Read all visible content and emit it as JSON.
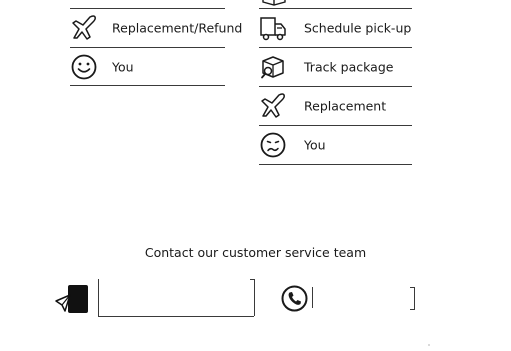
{
  "left_menu": {
    "items": [
      {
        "label": "Replacement/Refund",
        "icon": "airplane-icon"
      },
      {
        "label": "You",
        "icon": "smile-face-icon"
      }
    ]
  },
  "right_menu": {
    "items": [
      {
        "label": "Schedule pick-up",
        "icon": "delivery-truck-icon"
      },
      {
        "label": "Track package",
        "icon": "package-search-icon"
      },
      {
        "label": "Replacement",
        "icon": "airplane-icon"
      },
      {
        "label": "You",
        "icon": "sad-face-icon"
      }
    ]
  },
  "contact": {
    "title": "Contact our customer service team",
    "message_icon": "chat-message-icon",
    "message_value": "",
    "phone_icon": "phone-icon",
    "phone_value": ""
  },
  "colors": {
    "line": "#3a3a3a",
    "text": "#1a1a1a",
    "background": "#ffffff"
  }
}
